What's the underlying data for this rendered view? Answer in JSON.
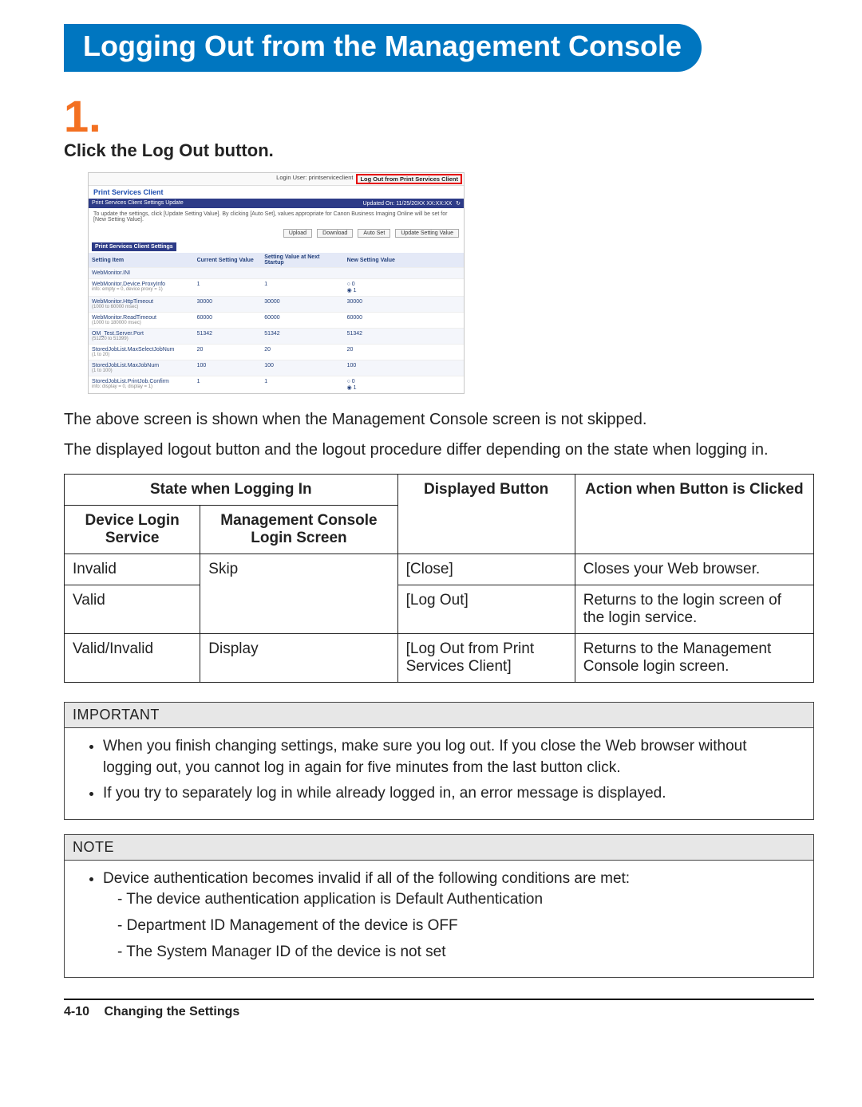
{
  "banner_title": "Logging Out from the Management Console",
  "step": {
    "num": "1.",
    "text": "Click the Log Out button."
  },
  "screenshot": {
    "login_user_label": "Login User: printserviceclient",
    "logout_button": "Log Out from Print Services Client",
    "app_title": "Print Services Client",
    "section_bar_left": "Print Services Client Settings Update",
    "section_bar_right": "Updated On: 11/25/20XX XX:XX:XX",
    "refresh_icon": "↻",
    "desc": "To update the settings, click [Update Setting Value]. By clicking [Auto Set], values appropriate for Canon Business Imaging Online will be set for [New Setting Value].",
    "buttons": {
      "upload": "Upload",
      "download": "Download",
      "autoset": "Auto Set",
      "update": "Update Setting Value"
    },
    "subsection_title": "Print Services Client Settings",
    "columns": {
      "item": "Setting Item",
      "current": "Current Setting Value",
      "next": "Setting Value at Next Startup",
      "new": "New Setting Value"
    },
    "rows": [
      {
        "item": "WebMonitor.INI",
        "sub": "",
        "cur": "",
        "next": "",
        "new": "",
        "newb": ""
      },
      {
        "item": "WebMonitor.Device.ProxyInfo",
        "sub": "info: empty = 0, device proxy = 1)",
        "cur": "1",
        "next": "1",
        "new": "0",
        "newb": "1"
      },
      {
        "item": "WebMonitor.HttpTimeout",
        "sub": "(1000 to 60000 msec)",
        "cur": "30000",
        "next": "30000",
        "new": "30000",
        "newb": ""
      },
      {
        "item": "WebMonitor.ReadTimeout",
        "sub": "(1000 to 180000 msec)",
        "cur": "60000",
        "next": "60000",
        "new": "60000",
        "newb": ""
      },
      {
        "item": "OM_Test.Server.Port",
        "sub": "(51220 to 51399)",
        "cur": "51342",
        "next": "51342",
        "new": "51342",
        "newb": ""
      },
      {
        "item": "StoredJobList.MaxSelectJobNum",
        "sub": "(1 to 20)",
        "cur": "20",
        "next": "20",
        "new": "20",
        "newb": ""
      },
      {
        "item": "StoredJobList.MaxJobNum",
        "sub": "(1 to 100)",
        "cur": "100",
        "next": "100",
        "new": "100",
        "newb": ""
      },
      {
        "item": "StoredJobList.PrintJob.Confirm",
        "sub": "info: display = 0, display = 1)",
        "cur": "1",
        "next": "1",
        "new": "0",
        "newb": "1"
      }
    ]
  },
  "para1": "The above screen is shown when the Management Console screen is not skipped.",
  "para2": "The displayed logout button and the logout procedure differ depending on the state when logging in.",
  "table": {
    "hdr_state": "State when Logging In",
    "hdr_dls": "Device Login Service",
    "hdr_mcs": "Management Console Login Screen",
    "hdr_btn": "Displayed Button",
    "hdr_action": "Action when Button is Clicked",
    "rows": [
      {
        "dls": "Invalid",
        "mcs": "Skip",
        "btn": "[Close]",
        "action": "Closes your Web browser."
      },
      {
        "dls": "Valid",
        "mcs": "",
        "btn": "[Log Out]",
        "action": "Returns to the login screen of the login service."
      },
      {
        "dls": "Valid/Invalid",
        "mcs": "Display",
        "btn": "[Log Out from Print Services Client]",
        "action": "Returns to the Management Console login screen."
      }
    ]
  },
  "important": {
    "title": "IMPORTANT",
    "b1": "When you finish changing settings, make sure you log out. If you close the Web browser without logging out, you cannot log in again for five minutes from the last button click.",
    "b2": "If you try to separately log in while already logged in, an error message is displayed."
  },
  "note": {
    "title": "NOTE",
    "b1": "Device authentication becomes invalid if all of the following conditions are met:",
    "s1": "The device authentication application is Default Authentication",
    "s2": "Department ID Management of the device is OFF",
    "s3": "The System Manager ID of the device is not set"
  },
  "footer": {
    "page": "4-10",
    "section": "Changing the Settings"
  }
}
